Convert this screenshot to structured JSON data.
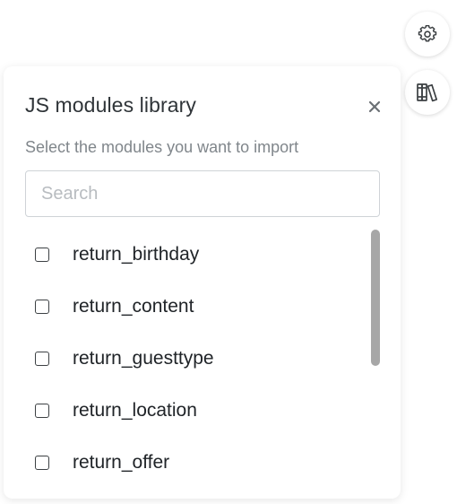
{
  "toolbar": {
    "settings_icon": "gear-icon",
    "library_icon": "books-library-icon"
  },
  "dialog": {
    "title": "JS modules library",
    "subtitle": "Select the modules you want to import",
    "close_icon": "close-icon",
    "search": {
      "placeholder": "Search",
      "value": ""
    },
    "modules": [
      {
        "label": "return_birthday",
        "checked": false
      },
      {
        "label": "return_content",
        "checked": false
      },
      {
        "label": "return_guesttype",
        "checked": false
      },
      {
        "label": "return_location",
        "checked": false
      },
      {
        "label": "return_offer",
        "checked": false
      }
    ]
  },
  "colors": {
    "title": "#2f3438",
    "subtitle": "#80868b",
    "scrollbar": "#a7a7a7",
    "border": "#cfd3d7"
  }
}
